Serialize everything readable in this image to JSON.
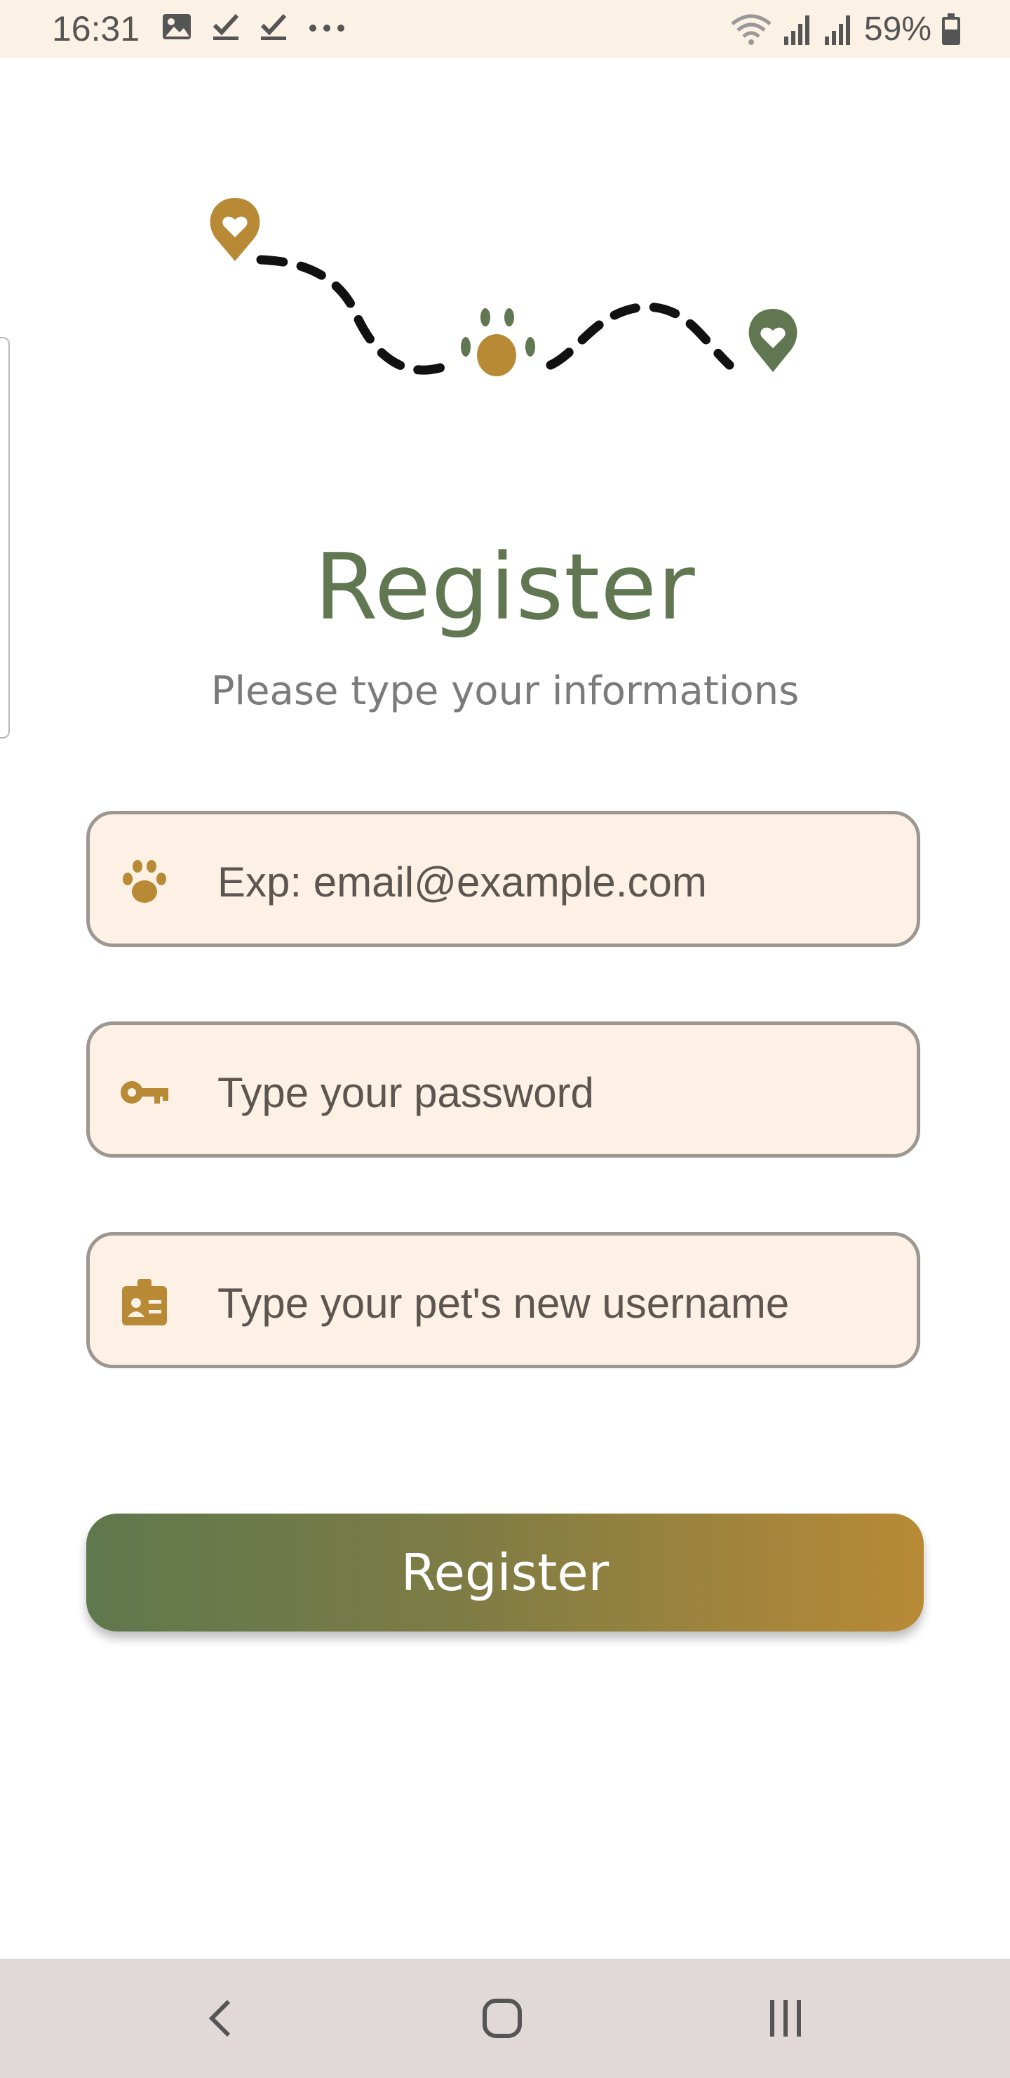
{
  "status_bar": {
    "time": "16:31",
    "battery": "59%",
    "icons": [
      "image-icon",
      "check-icon",
      "check-icon",
      "more-icon",
      "wifi-icon",
      "signal-icon",
      "signal-icon",
      "battery-icon"
    ]
  },
  "page": {
    "title": "Register",
    "subtitle": "Please type your informations"
  },
  "form": {
    "email": {
      "placeholder": "Exp: email@example.com",
      "value": "",
      "icon": "paw-icon"
    },
    "password": {
      "placeholder": "Type your password",
      "value": "",
      "icon": "key-icon"
    },
    "username": {
      "placeholder": "Type your pet's new username",
      "value": "",
      "icon": "badge-icon"
    },
    "submit_label": "Register"
  },
  "colors": {
    "primary_green": "#617752",
    "accent_gold": "#b88a36",
    "field_background": "#fcf1e4",
    "field_border": "#9e9690"
  },
  "navigation": {
    "icons": [
      "back-icon",
      "home-icon",
      "recents-icon"
    ]
  }
}
